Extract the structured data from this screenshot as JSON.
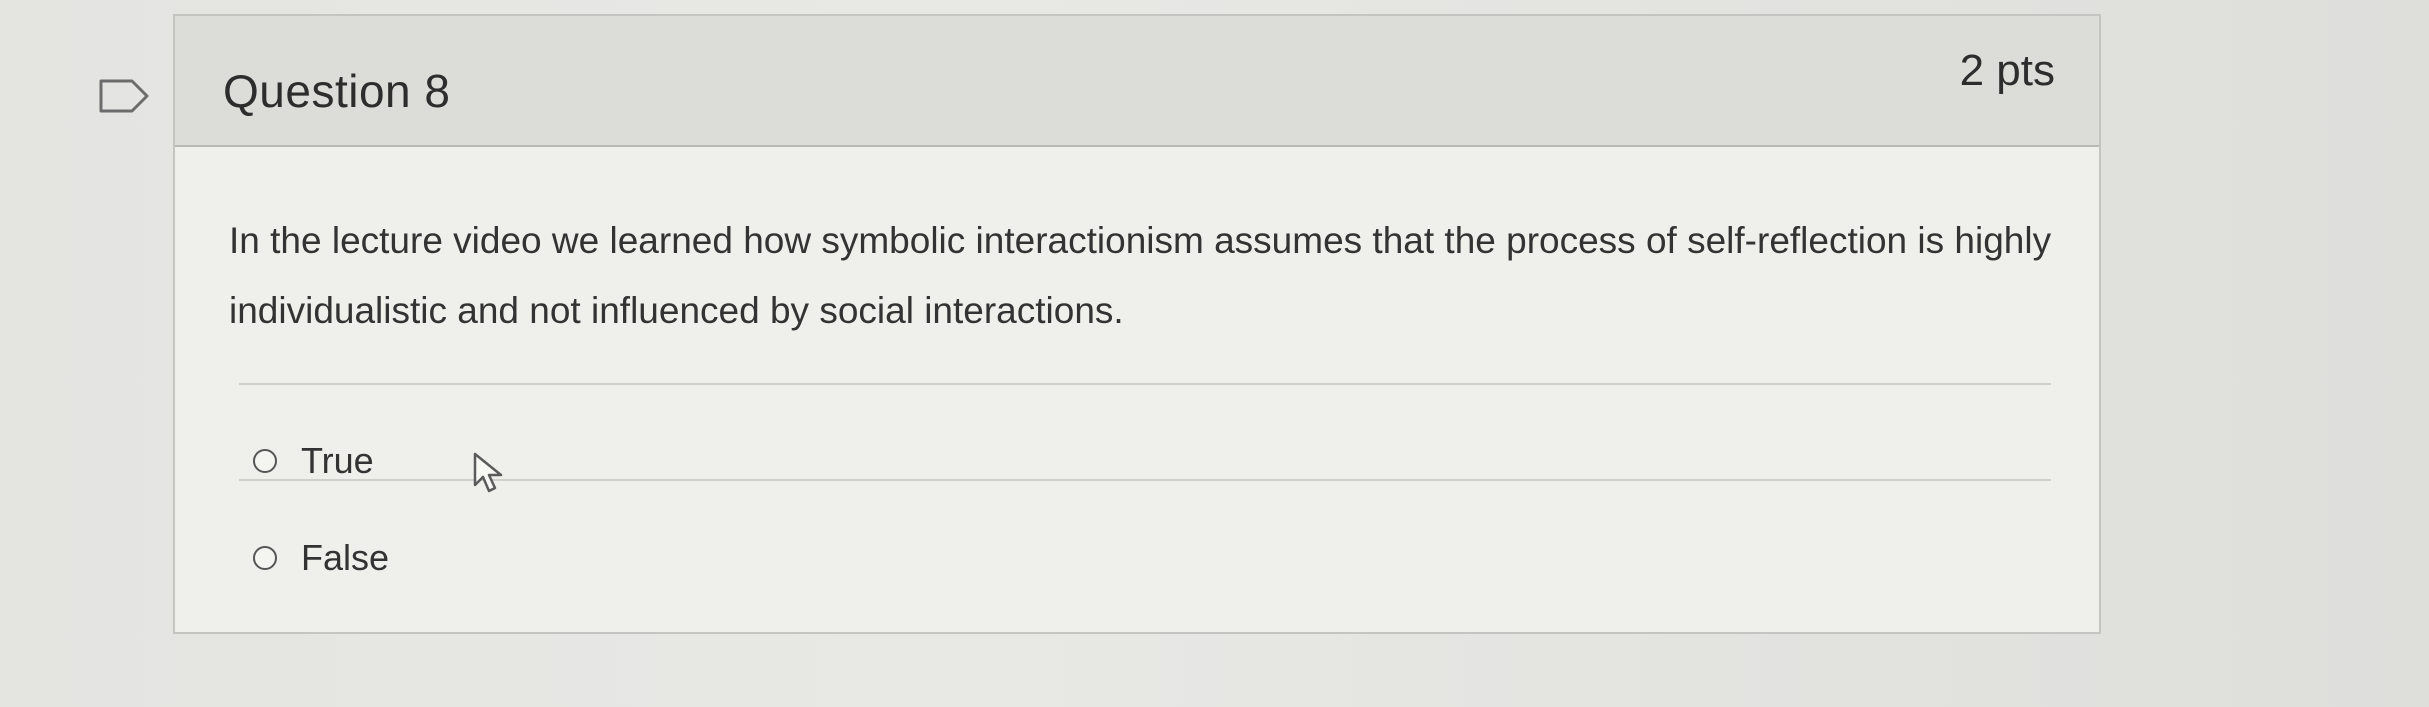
{
  "question": {
    "title": "Question 8",
    "points": "2 pts",
    "text": "In the lecture video we learned how symbolic interactionism assumes that the process of self-reflection is highly individualistic and not influenced by social interactions.",
    "answers": [
      {
        "label": "True",
        "selected": false
      },
      {
        "label": "False",
        "selected": false
      }
    ]
  },
  "icons": {
    "flag": "bookmark-flag-icon",
    "cursor": "mouse-pointer-icon"
  },
  "colors": {
    "header_background": "#dcdcd9",
    "card_background": "#efefec",
    "text": "#333333"
  }
}
